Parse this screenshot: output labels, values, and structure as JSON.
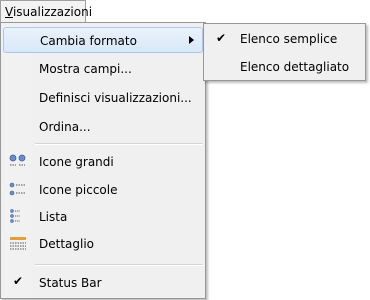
{
  "menubar": {
    "menu_title_accel": "V",
    "menu_title_rest": "isualizzazioni"
  },
  "menu": {
    "items": [
      {
        "label": "Cambia formato",
        "has_submenu": true,
        "highlighted": true
      },
      {
        "label": "Mostra campi..."
      },
      {
        "label": "Definisci visualizzazioni..."
      },
      {
        "label": "Ordina..."
      },
      {
        "label": "Icone grandi",
        "icon": "large-icons-icon"
      },
      {
        "label": "Icone piccole",
        "icon": "small-icons-icon"
      },
      {
        "label": "Lista",
        "icon": "list-view-icon"
      },
      {
        "label": "Dettaglio",
        "icon": "details-view-icon"
      },
      {
        "label": "Status Bar",
        "checked": true
      }
    ]
  },
  "submenu": {
    "items": [
      {
        "label": "Elenco semplice",
        "checked": true
      },
      {
        "label": "Elenco dettagliato",
        "checked": false
      }
    ]
  },
  "check_glyph": "✔"
}
